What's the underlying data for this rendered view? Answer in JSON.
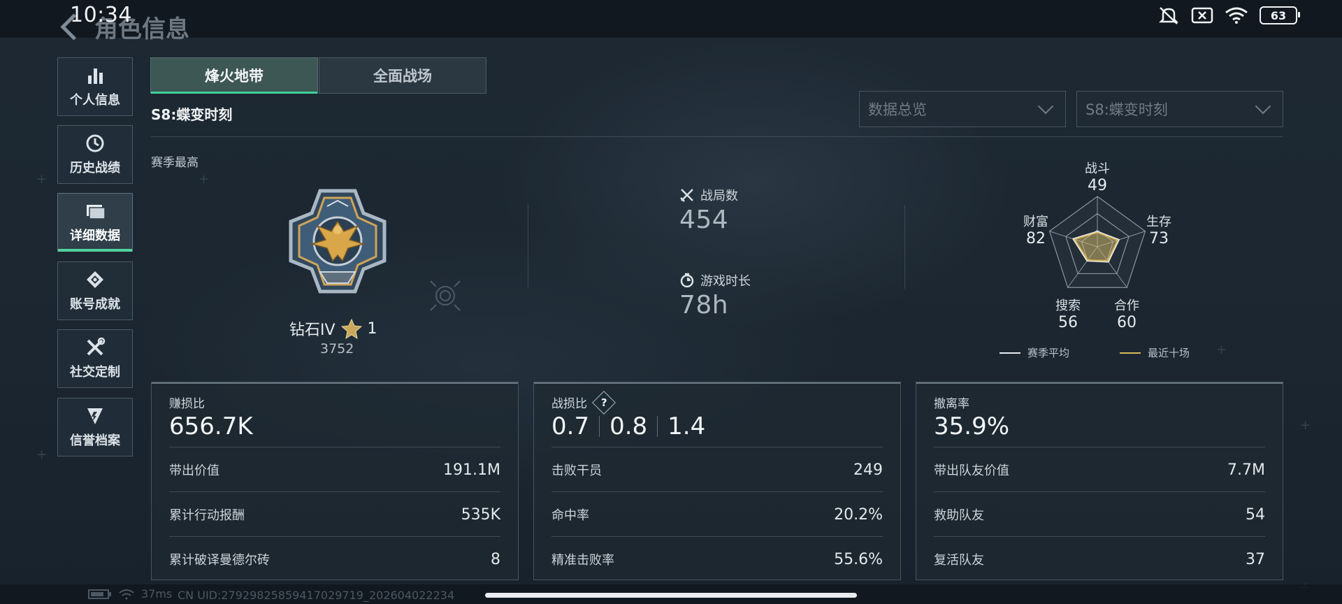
{
  "status_bar": {
    "time": "10:34",
    "battery_level": "63"
  },
  "header": {
    "title": "角色信息"
  },
  "sidebar": {
    "items": [
      {
        "label": "个人信息",
        "icon": "bar-chart-icon",
        "active": false
      },
      {
        "label": "历史战绩",
        "icon": "history-icon",
        "active": false
      },
      {
        "label": "详细数据",
        "icon": "folder-icon",
        "active": true
      },
      {
        "label": "账号成就",
        "icon": "achievement-icon",
        "active": false
      },
      {
        "label": "社交定制",
        "icon": "wrench-icon",
        "active": false
      },
      {
        "label": "信誉档案",
        "icon": "shield-icon",
        "active": false
      }
    ]
  },
  "tabs": [
    {
      "label": "烽火地带",
      "active": true
    },
    {
      "label": "全面战场",
      "active": false
    }
  ],
  "season_title": "S8:蝶变时刻",
  "filters": {
    "data_view": "数据总览",
    "season": "S8:蝶变时刻"
  },
  "season_best": {
    "label": "赛季最高",
    "rank_name": "钻石IV",
    "stars": "1",
    "score": "3752"
  },
  "summary": {
    "matches_label": "战局数",
    "matches_value": "454",
    "playtime_label": "游戏时长",
    "playtime_value": "78h"
  },
  "radar": {
    "axes": [
      {
        "label": "战斗",
        "value": 49
      },
      {
        "label": "生存",
        "value": 73
      },
      {
        "label": "合作",
        "value": 60
      },
      {
        "label": "搜索",
        "value": 56
      },
      {
        "label": "财富",
        "value": 82
      }
    ],
    "legend": [
      {
        "label": "赛季平均",
        "color": "#e8ecef"
      },
      {
        "label": "最近十场",
        "color": "#d9b85a"
      }
    ]
  },
  "cards": [
    {
      "title": "赚损比",
      "big": "656.7K",
      "rows": [
        {
          "label": "带出价值",
          "value": "191.1M"
        },
        {
          "label": "累计行动报酬",
          "value": "535K"
        },
        {
          "label": "累计破译曼德尔砖",
          "value": "8"
        }
      ]
    },
    {
      "title": "战损比",
      "big_values": [
        "0.7",
        "0.8",
        "1.4"
      ],
      "help": "?",
      "rows": [
        {
          "label": "击败干员",
          "value": "249"
        },
        {
          "label": "命中率",
          "value": "20.2%"
        },
        {
          "label": "精准击败率",
          "value": "55.6%"
        }
      ]
    },
    {
      "title": "撤离率",
      "big": "35.9%",
      "rows": [
        {
          "label": "带出队友价值",
          "value": "7.7M"
        },
        {
          "label": "救助队友",
          "value": "54"
        },
        {
          "label": "复活队友",
          "value": "37"
        }
      ]
    }
  ],
  "footer": {
    "ping": "37ms",
    "uid": "CN UID:27929825859417029719_202604022234"
  }
}
